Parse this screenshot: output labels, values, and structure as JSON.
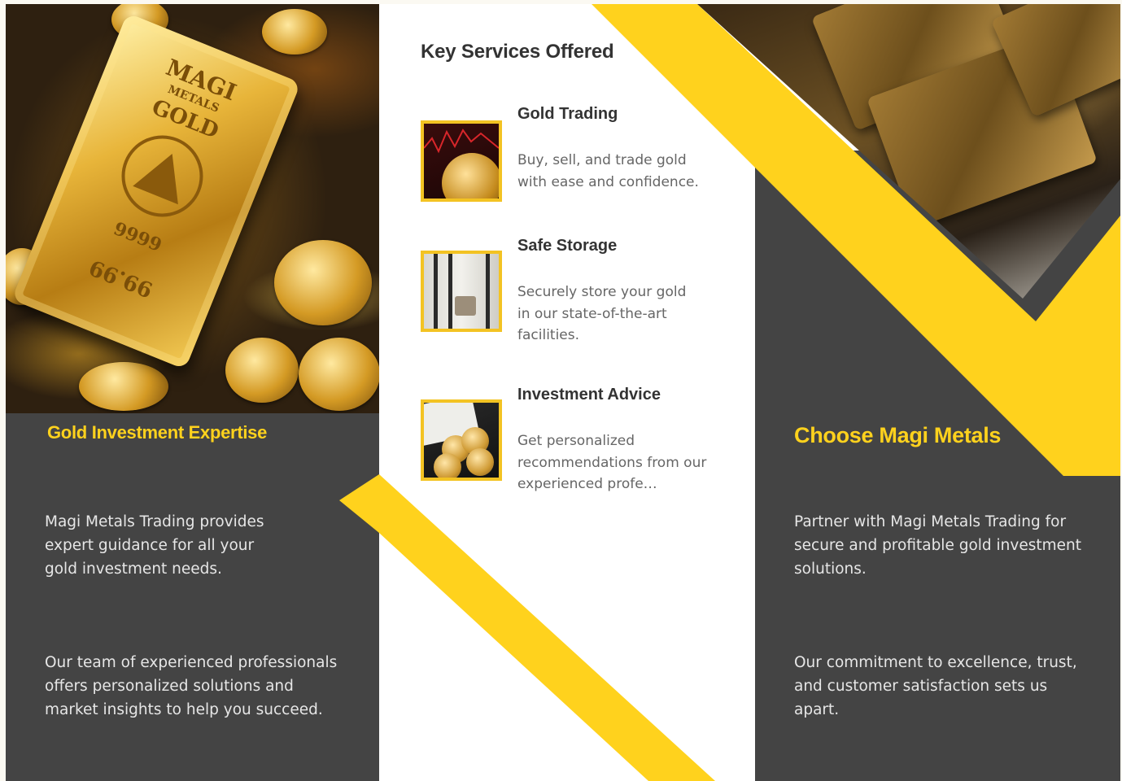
{
  "colors": {
    "accent_yellow": "#ffd21d",
    "dark_panel": "#444444",
    "white_panel": "#ffffff",
    "heading_dark": "#333333",
    "body_gray": "#666666",
    "thumbnail_border": "#f3c323"
  },
  "left_panel": {
    "image_alt": "",
    "bar_stamp": {
      "line1": "MAGI",
      "line2": "METALS",
      "line3": "GOLD",
      "purity1": "9999",
      "purity2": "99.99"
    },
    "heading": "Gold Investment Expertise",
    "paragraph1": "Magi Metals Trading provides expert guidance for all your gold investment needs.",
    "paragraph2": "Our team of experienced professionals offers personalized solutions and market insights to help you succeed."
  },
  "middle_panel": {
    "title": "Key Services Offered",
    "services": [
      {
        "title": "Gold Trading",
        "description": "Buy, sell, and trade gold with ease and confidence.",
        "icon": "gold-trading-image"
      },
      {
        "title": "Safe Storage",
        "description": "Securely store your gold in our state-of-the-art facilities.",
        "icon": "safe-storage-image"
      },
      {
        "title": "Investment Advice",
        "description": "Get personalized recommendations from our experienced profe…",
        "icon": "investment-advice-image"
      }
    ]
  },
  "right_panel": {
    "heading": "Choose Magi Metals",
    "paragraph1": "Partner with Magi Metals Trading for secure and profitable gold investment solutions.",
    "paragraph2": "Our commitment to excellence, trust, and customer satisfaction sets us apart."
  }
}
